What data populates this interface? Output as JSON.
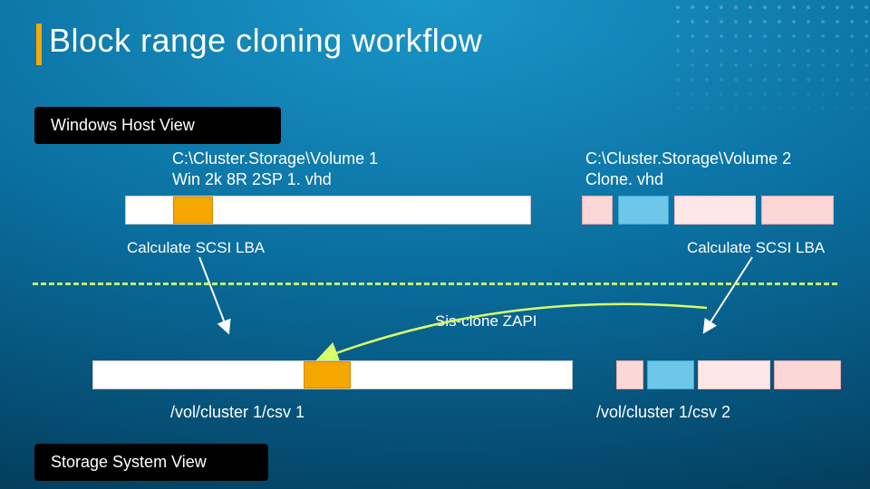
{
  "title_html": "Block <b>range cloning workflow</b>",
  "host_view_label": "Windows Host View",
  "storage_view_label": "Storage System View",
  "vol1_path_line1": "C:\\Cluster.Storage\\Volume 1",
  "vol1_path_line2": "Win 2k 8R 2SP 1. vhd",
  "vol2_path_line1": "C:\\Cluster.Storage\\Volume 2",
  "vol2_path_line2": "Clone. vhd",
  "calc_left": "Calculate SCSI LBA",
  "calc_right": "Calculate SCSI LBA",
  "sis_clone_label": "Sis-clone ZAPI",
  "csv1_label": "/vol/cluster 1/csv 1",
  "csv2_label": "/vol/cluster 1/csv 2",
  "colors": {
    "accent_orange": "#f7a900",
    "divider": "#d6ff6a",
    "block_orange": "#f5a700",
    "block_pink": "#fbd7d7",
    "block_lightpink": "#fde7e7",
    "block_blue": "#6ec6e8"
  }
}
